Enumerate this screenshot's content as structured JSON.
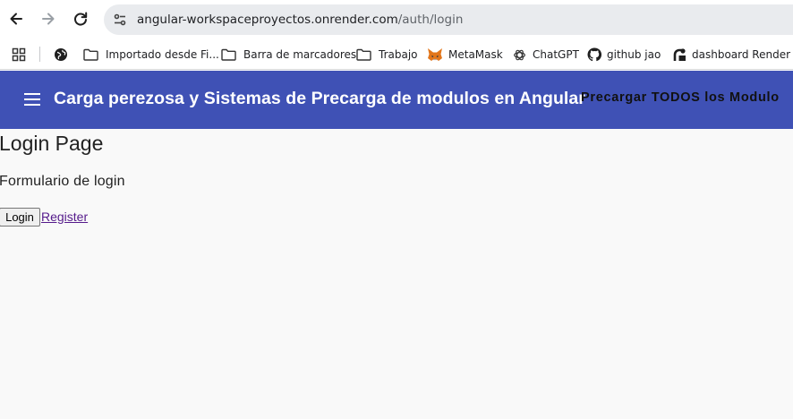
{
  "browser": {
    "url_host": "angular-workspaceproyectos.onrender.com",
    "url_path": "/auth/login",
    "bookmarks": [
      {
        "label": "Importado desde Fi...",
        "icon": "folder-icon"
      },
      {
        "label": "Barra de marcadores",
        "icon": "folder-icon"
      },
      {
        "label": "Trabajo",
        "icon": "folder-icon"
      },
      {
        "label": "MetaMask",
        "icon": "metamask-fox-icon"
      },
      {
        "label": "ChatGPT",
        "icon": "chatgpt-icon"
      },
      {
        "label": "github jao",
        "icon": "github-icon"
      },
      {
        "label": "dashboard Render",
        "icon": "render-icon"
      }
    ]
  },
  "toolbar": {
    "title": "Carga perezosa y Sistemas de Precarga de modulos en Angular",
    "preload_label": "Precargar TODOS los Modulo",
    "color": "#3f51b5"
  },
  "page": {
    "title": "Login Page",
    "description": "Formulario de login",
    "login_label": "Login",
    "register_label": "Register"
  }
}
